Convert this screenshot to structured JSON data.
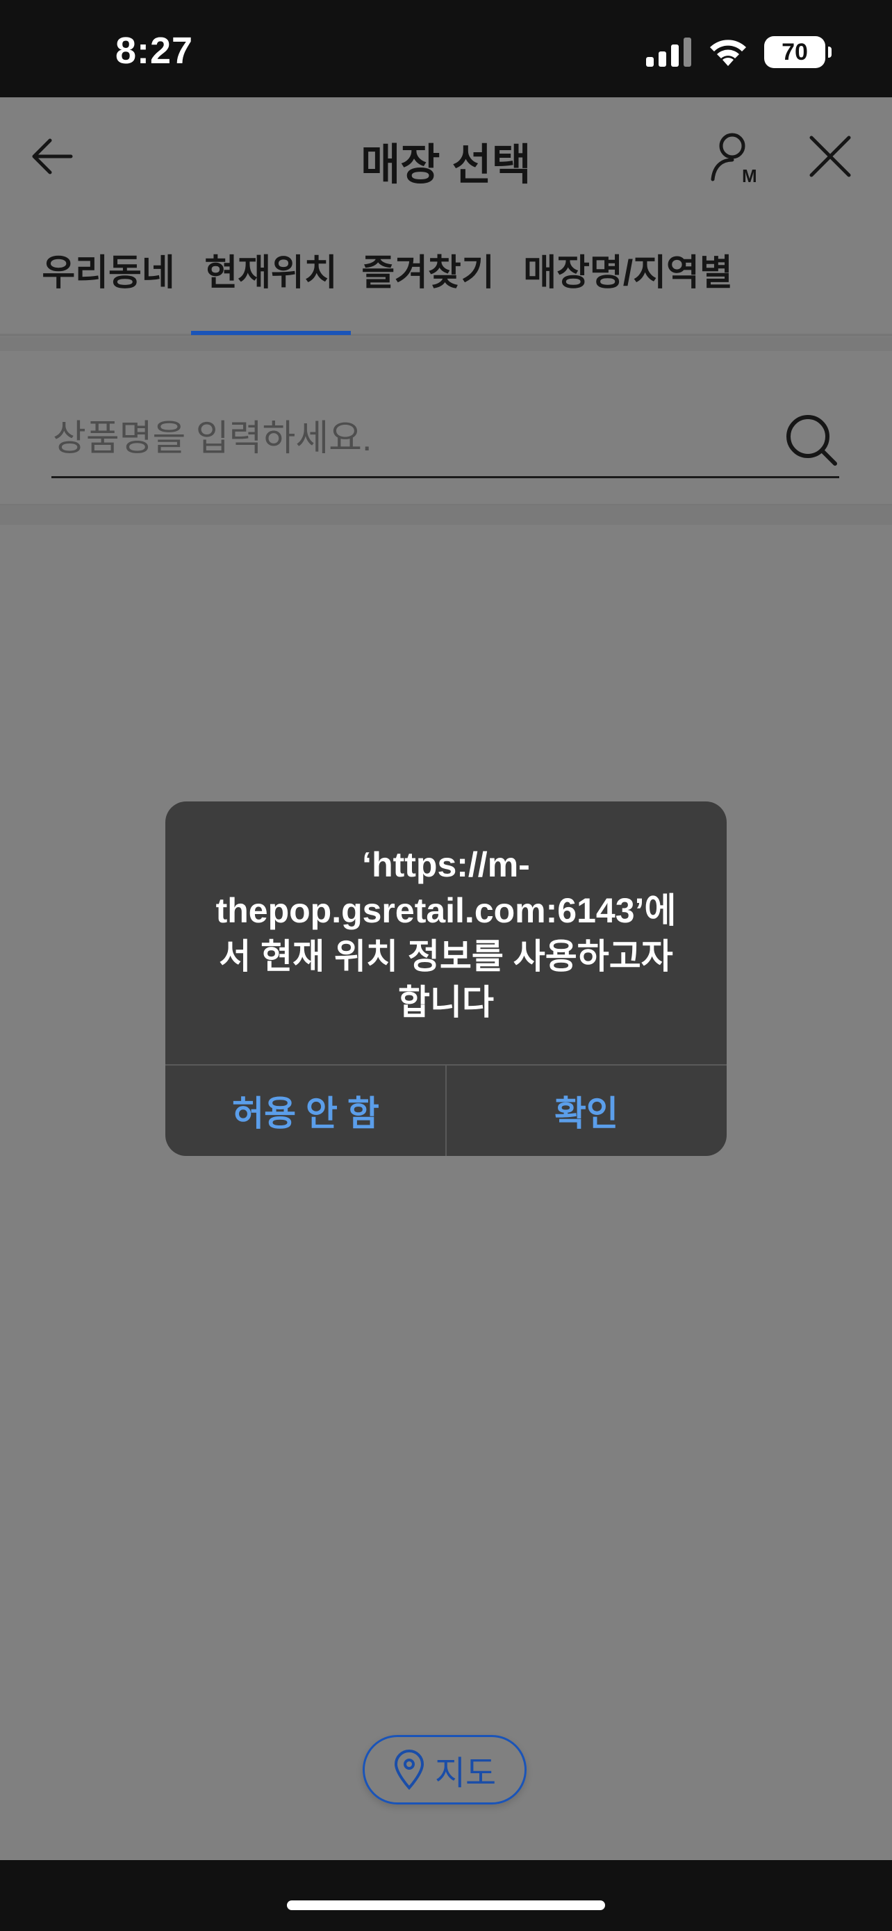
{
  "status_bar": {
    "time": "8:27",
    "battery": "70"
  },
  "header": {
    "title": "매장 선택"
  },
  "tabs": [
    {
      "label": "우리동네"
    },
    {
      "label": "현재위치",
      "active": true
    },
    {
      "label": "즐겨찾기"
    },
    {
      "label": "매장명/지역별"
    }
  ],
  "search": {
    "placeholder": "상품명을 입력하세요."
  },
  "dialog": {
    "message": "‘https://m-thepop.gsretail.com:6143’에서 현재 위치 정보를 사용하고자 합니다",
    "deny_label": "허용 안 함",
    "confirm_label": "확인"
  },
  "map_button": {
    "label": "지도"
  },
  "colors": {
    "accent": "#1a54b8",
    "dialog_button": "#5b9eea",
    "dimmed_background": "#808080"
  }
}
